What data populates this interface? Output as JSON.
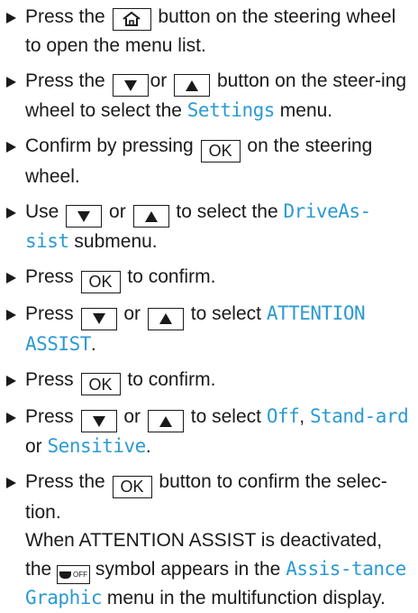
{
  "colors": {
    "display_text": "#2b9ad2",
    "text": "#1a1a1a"
  },
  "steps": [
    {
      "a": "Press the",
      "key1": "home",
      "b": "button on the steering wheel to open the menu list."
    },
    {
      "a": "Press the",
      "key1": "down",
      "or": "or",
      "key2": "up",
      "b": "button on the steer-ing wheel to select the",
      "disp": "Settings",
      "c": "menu."
    },
    {
      "a": "Confirm by pressing",
      "key1_label": "OK",
      "b": "on the steering wheel."
    },
    {
      "a": "Use",
      "key1": "down",
      "or": "or",
      "key2": "up",
      "b": "to select the",
      "disp": "DriveAs-sist",
      "c": "submenu."
    },
    {
      "a": "Press",
      "key1_label": "OK",
      "b": "to confirm."
    },
    {
      "a": "Press",
      "key1": "down",
      "or": "or",
      "key2": "up",
      "b": "to select",
      "disp": "ATTENTION ASSIST",
      "c": "."
    },
    {
      "a": "Press",
      "key1_label": "OK",
      "b": "to confirm."
    },
    {
      "a": "Press",
      "key1": "down",
      "or": "or",
      "key2": "up",
      "b": "to select",
      "disp1": "Off",
      "sep": ",",
      "disp2": "Stand-ard",
      "or2": "or",
      "disp3": "Sensitive",
      "c": "."
    },
    {
      "a": "Press the",
      "key1_label": "OK",
      "b": "button to confirm the selec-tion.",
      "note_a": "When ATTENTION ASSIST is deactivated, the",
      "note_symbol": "coffee-cup-off-icon",
      "note_symbol_label": "OFF",
      "note_b": "symbol appears in the",
      "note_disp": "Assis-tance Graphic",
      "note_c": "menu in the multifunction display."
    }
  ]
}
